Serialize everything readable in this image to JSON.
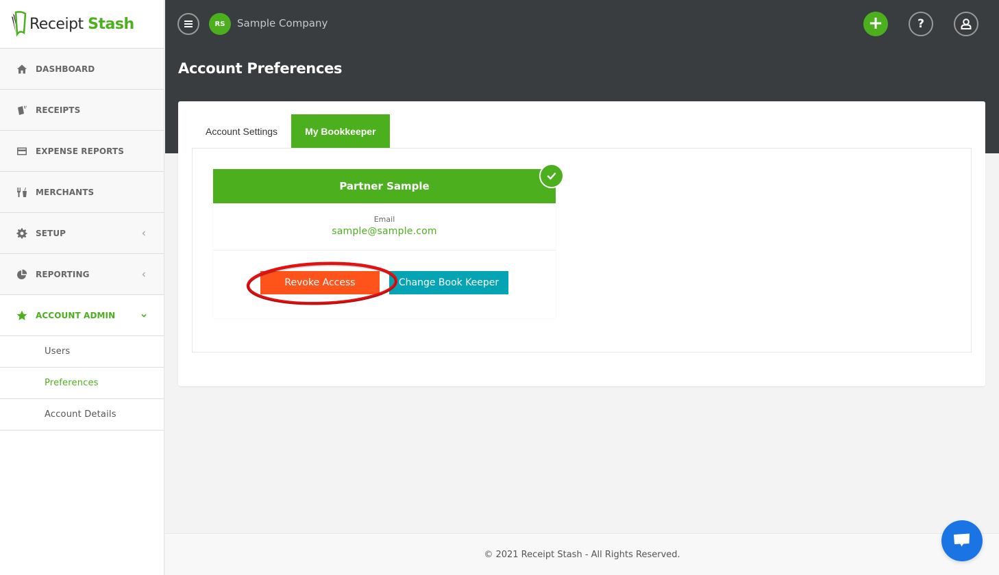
{
  "brand": {
    "name_dark": "Receipt",
    "name_green": "Stash",
    "primary_color": "#4caf1e"
  },
  "sidebar": {
    "items": [
      {
        "label": "DASHBOARD",
        "icon": "home-icon"
      },
      {
        "label": "RECEIPTS",
        "icon": "receipts-icon"
      },
      {
        "label": "EXPENSE REPORTS",
        "icon": "credit-card-icon"
      },
      {
        "label": "MERCHANTS",
        "icon": "utensils-icon"
      },
      {
        "label": "SETUP",
        "icon": "gear-icon",
        "expandable": true
      },
      {
        "label": "REPORTING",
        "icon": "pie-chart-icon",
        "expandable": true
      },
      {
        "label": "ACCOUNT ADMIN",
        "icon": "star-icon",
        "expanded": true,
        "active": true
      }
    ],
    "subitems": [
      {
        "label": "Users"
      },
      {
        "label": "Preferences",
        "active": true
      },
      {
        "label": "Account Details"
      }
    ]
  },
  "header": {
    "company_initials": "RS",
    "company_name": "Sample Company",
    "page_title": "Account Preferences",
    "add_icon": "+",
    "help_icon": "?"
  },
  "tabs": [
    {
      "label": "Account Settings",
      "active": false
    },
    {
      "label": "My Bookkeeper",
      "active": true
    }
  ],
  "bookkeeper": {
    "name": "Partner Sample",
    "email_label": "Email",
    "email": "sample@sample.com",
    "revoke_label": "Revoke Access",
    "change_label": "Change Book Keeper",
    "revoke_color": "#fe531b",
    "change_color": "#05a4b4"
  },
  "footer": {
    "copyright": "© 2021 Receipt Stash - All Rights Reserved."
  }
}
